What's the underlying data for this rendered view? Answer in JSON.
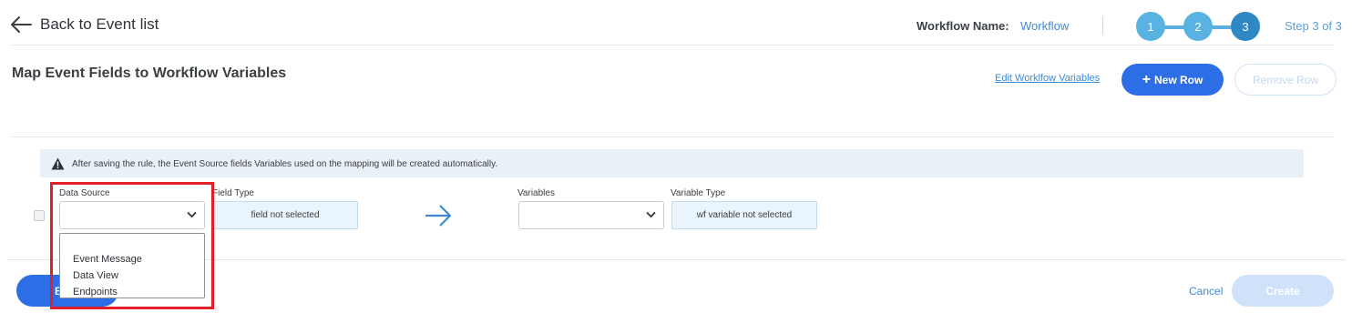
{
  "header": {
    "back_label": "Back to Event list",
    "workflow_name_label": "Workflow Name:",
    "workflow_name_value": "Workflow",
    "steps": [
      "1",
      "2",
      "3"
    ],
    "step_count": "Step 3 of 3"
  },
  "page": {
    "title": "Map Event Fields to Workflow Variables",
    "edit_variables_link": "Edit Worklfow Variables",
    "new_row_label": "New Row",
    "remove_row_label": "Remove Row"
  },
  "info_banner": {
    "text": "After saving the rule, the Event Source fields Variables used on the mapping will be created automatically."
  },
  "mapping_row": {
    "data_source_label": "Data Source",
    "field_type_label": "Field Type",
    "field_type_value": "field not selected",
    "variables_label": "Variables",
    "variable_type_label": "Variable Type",
    "variable_type_value": "wf variable not selected"
  },
  "data_source_dropdown": {
    "options": [
      "Event Message",
      "Data View",
      "Endpoints"
    ]
  },
  "footer": {
    "back_button_label": "Back",
    "cancel_label": "Cancel",
    "create_label": "Create"
  },
  "colors": {
    "primary": "#2d6de6",
    "link": "#3f8ad4",
    "step_done": "#5ab2e3",
    "step_active": "#2f88c4",
    "highlight": "#e41e26"
  },
  "icons": [
    "arrow-left-icon",
    "warning-icon",
    "chevron-down-icon",
    "arrow-right-icon",
    "plus-icon"
  ]
}
